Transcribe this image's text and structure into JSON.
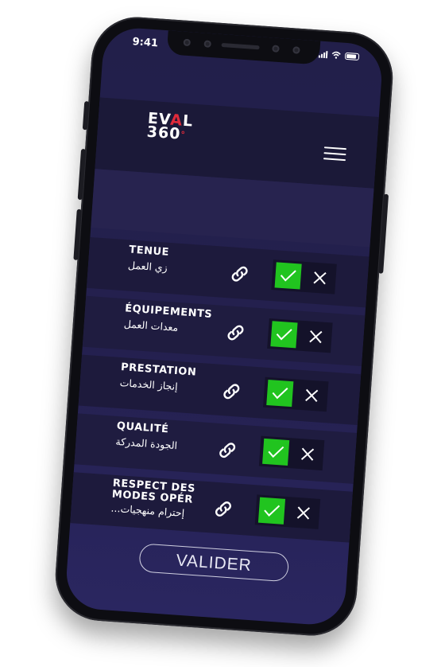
{
  "status_bar": {
    "time": "9:41"
  },
  "brand": {
    "logo_line1_start": "EV",
    "logo_line1_accent": "A",
    "logo_line1_end": "L",
    "logo_line2": "360",
    "logo_degree": "°"
  },
  "criteria": [
    {
      "label_fr": "TENUE",
      "label_ar": "زي العمل"
    },
    {
      "label_fr": "ÉQUIPEMENTS",
      "label_ar": "معدات العمل"
    },
    {
      "label_fr": "PRESTATION",
      "label_ar": "إنجاز الخدمات"
    },
    {
      "label_fr": "QUALITÉ",
      "label_ar": "الجودة المدركة"
    },
    {
      "label_fr": "RESPECT DES MODES OPÉR",
      "label_ar": "إحترام منهجيات..."
    }
  ],
  "submit": {
    "label": "VALIDER"
  },
  "colors": {
    "accent": "#e02a3a",
    "check_green": "#21c41f",
    "background": "#221f4a"
  },
  "icons": {
    "link": "link-icon",
    "check": "check-icon",
    "cross": "close-icon",
    "menu": "hamburger-menu-icon"
  }
}
